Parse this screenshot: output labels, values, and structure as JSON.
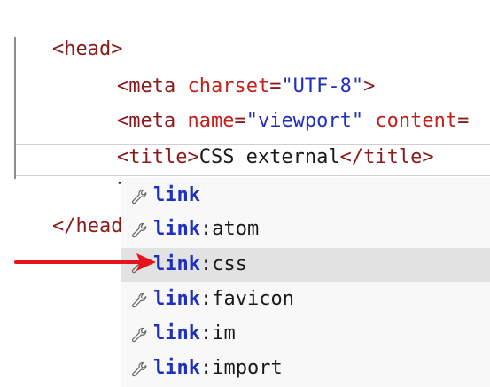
{
  "code_lines": [
    {
      "open": "<head>"
    },
    {
      "tag_open": "<meta ",
      "attr1": "charset",
      "eq1": "=",
      "val1": "\"UTF-8\"",
      "close": ">"
    },
    {
      "tag_open": "<meta ",
      "attr1": "name",
      "eq1": "=",
      "val1": "\"viewport\"",
      "space": " ",
      "attr2": "content",
      "eq2": "="
    },
    {
      "tag_open": "<title>",
      "text": "CSS external",
      "tag_close": "</title>"
    },
    {
      "text": "link"
    },
    {
      "close": "</head>"
    }
  ],
  "autocomplete": {
    "icon": "wrench-icon",
    "items": [
      {
        "keyword": "link",
        "suffix": ""
      },
      {
        "keyword": "link",
        "suffix": ":atom"
      },
      {
        "keyword": "link",
        "suffix": ":css"
      },
      {
        "keyword": "link",
        "suffix": ":favicon"
      },
      {
        "keyword": "link",
        "suffix": ":im"
      },
      {
        "keyword": "link",
        "suffix": ":import"
      }
    ],
    "selected_index": 2
  },
  "colors": {
    "tag": "#8b1a1a",
    "attribute": "#c4201a",
    "string": "#1f2fbf",
    "keyword": "#1f2fbf",
    "arrow": "#e8121b",
    "selection": "#e2e2e2"
  }
}
